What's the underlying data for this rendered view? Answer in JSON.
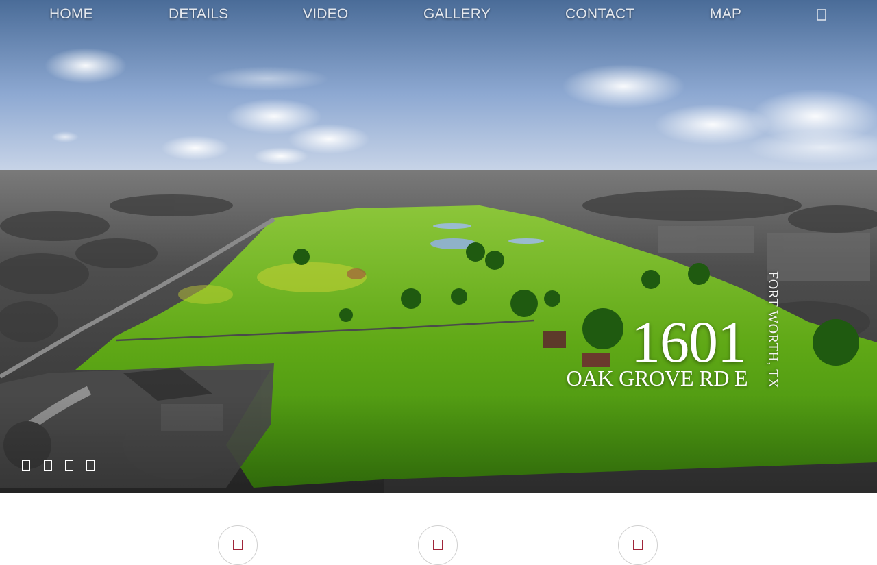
{
  "nav": {
    "items": [
      {
        "label": "HOME"
      },
      {
        "label": "DETAILS"
      },
      {
        "label": "VIDEO"
      },
      {
        "label": "GALLERY"
      },
      {
        "label": "CONTACT"
      },
      {
        "label": "MAP"
      }
    ],
    "extra_icon": "menu-icon"
  },
  "hero": {
    "number": "1601",
    "street": "OAK GROVE RD E",
    "city": "FORT WORTH, TX"
  },
  "slideshow": {
    "dot_count": 4
  },
  "features": [
    {
      "icon": "feature-icon-1"
    },
    {
      "icon": "feature-icon-2"
    },
    {
      "icon": "feature-icon-3"
    }
  ],
  "colors": {
    "accent": "#a0263a",
    "nav_text": "#e4e8ee",
    "field_green": "#5da414",
    "sky_blue": "#9fb7da"
  }
}
